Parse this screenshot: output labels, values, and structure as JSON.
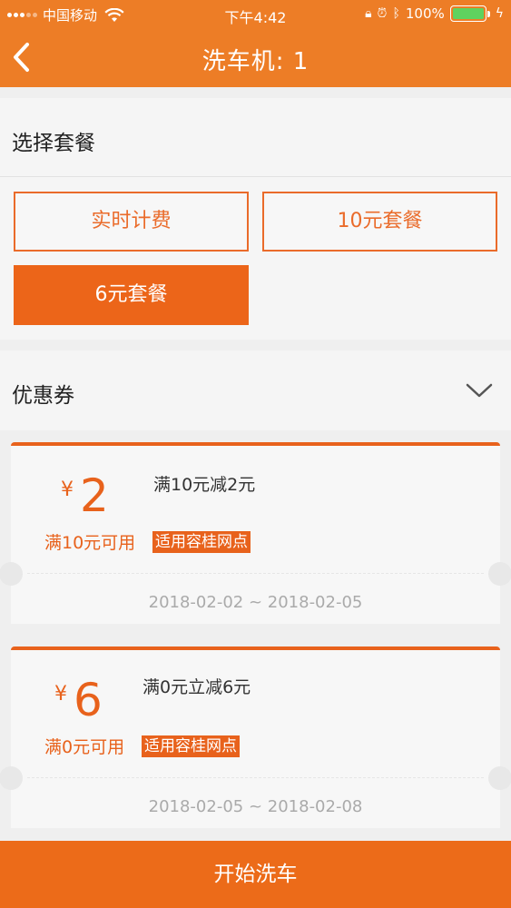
{
  "status_bar": {
    "carrier": "中国移动",
    "time": "下午4:42",
    "battery": "100%",
    "icons": [
      "signal-icon",
      "wifi-icon",
      "orientation-lock-icon",
      "alarm-icon",
      "bluetooth-icon",
      "battery-icon",
      "charging-icon"
    ]
  },
  "nav": {
    "title": "洗车机: 1",
    "back_icon": "back-chevron-icon"
  },
  "packages": {
    "title": "选择套餐",
    "options": [
      {
        "label": "实时计费",
        "selected": false
      },
      {
        "label": "10元套餐",
        "selected": false
      },
      {
        "label": "6元套餐",
        "selected": true
      }
    ]
  },
  "coupons": {
    "title": "优惠券",
    "chevron_icon": "chevron-down-icon",
    "items": [
      {
        "currency": "¥",
        "amount": "2",
        "rule": "满10元减2元",
        "condition": "满10元可用",
        "tag": "适用容桂网点",
        "valid_from": "2018-02-02",
        "valid_to": "2018-02-05",
        "date_range": "2018-02-02 ~ 2018-02-05"
      },
      {
        "currency": "¥",
        "amount": "6",
        "rule": "满0元立减6元",
        "condition": "满0元可用",
        "tag": "适用容桂网点",
        "valid_from": "2018-02-05",
        "valid_to": "2018-02-08",
        "date_range": "2018-02-05 ~ 2018-02-08"
      }
    ]
  },
  "actions": {
    "start_label": "开始洗车"
  },
  "colors": {
    "brand": "#ed7d26",
    "accent": "#e8621c",
    "selected_bg": "#ec6519",
    "battery": "#5fd25f"
  }
}
